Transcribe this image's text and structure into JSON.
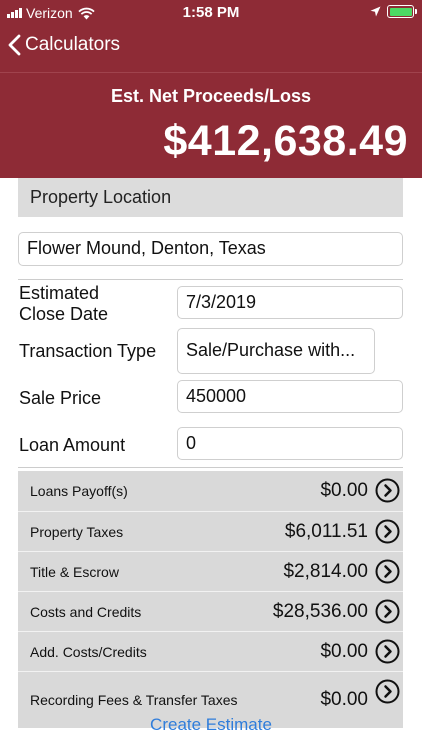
{
  "status": {
    "carrier": "Verizon",
    "time": "1:58 PM"
  },
  "nav": {
    "back_label": "Calculators"
  },
  "header": {
    "label": "Est. Net Proceeds/Loss",
    "value": "$412,638.49"
  },
  "location": {
    "section_title": "Property Location",
    "value": "Flower Mound, Denton, Texas"
  },
  "form": {
    "close_date_label": "Estimated Close Date",
    "close_date_value": "7/3/2019",
    "transaction_type_label": "Transaction Type",
    "transaction_type_value": "Sale/Purchase with...",
    "sale_price_label": "Sale Price",
    "sale_price_value": "450000",
    "loan_amount_label": "Loan Amount",
    "loan_amount_value": "0"
  },
  "rows": [
    {
      "label": "Loans Payoff(s)",
      "value": "$0.00"
    },
    {
      "label": "Property Taxes",
      "value": "$6,011.51"
    },
    {
      "label": "Title & Escrow",
      "value": "$2,814.00"
    },
    {
      "label": "Costs and Credits",
      "value": "$28,536.00"
    },
    {
      "label": "Add. Costs/Credits",
      "value": "$0.00"
    },
    {
      "label": "Recording Fees & Transfer Taxes",
      "value": "$0.00"
    }
  ],
  "footer": {
    "create_label": "Create Estimate"
  },
  "colors": {
    "brand": "#8e2b36",
    "link": "#2f7ddb",
    "battery": "#4cd964"
  },
  "icons": [
    "signal-icon",
    "wifi-icon",
    "location-arrow-icon",
    "battery-icon",
    "chevron-left-icon",
    "circle-chevron-right-icon"
  ]
}
